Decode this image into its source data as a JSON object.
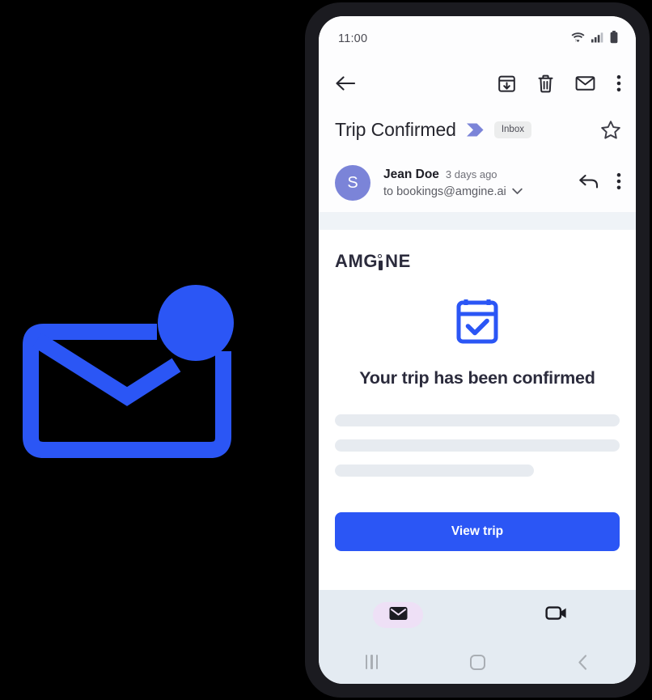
{
  "illustration": {
    "name": "envelope-with-notification-dot",
    "color": "#2b56f5",
    "background": "#000000"
  },
  "phone": {
    "frame_color": "#1b1b20",
    "screen_background": "#ffffff"
  },
  "status_bar": {
    "time": "11:00",
    "icons": [
      "wifi-icon",
      "cellular-signal-icon",
      "battery-icon"
    ]
  },
  "toolbar": {
    "back_icon": "arrow-left-icon",
    "actions": [
      {
        "icon": "archive-icon",
        "label": "Archive"
      },
      {
        "icon": "delete-icon",
        "label": "Delete"
      },
      {
        "icon": "mark-unread-icon",
        "label": "Mark unread"
      },
      {
        "icon": "more-vert-icon",
        "label": "More options"
      }
    ]
  },
  "subject": {
    "title": "Trip Confirmed",
    "label_chevron_color": "#7b84d8",
    "badge": "Inbox",
    "star_icon": "star-outline-icon"
  },
  "sender": {
    "avatar_initial": "S",
    "avatar_color": "#7b84d8",
    "name": "Jean Doe",
    "time": "3 days ago",
    "recipient": "to bookings@amgine.ai",
    "expand_icon": "chevron-down-icon",
    "reply_icon": "reply-icon",
    "more_icon": "more-vert-icon"
  },
  "email_body": {
    "brand_prefix": "AMG",
    "brand_suffix": "NE",
    "hero_icon": "calendar-check-icon",
    "hero_icon_color": "#2b56f5",
    "heading": "Your trip has been confirmed",
    "skeleton_widths": [
      "100%",
      "100%",
      "70%"
    ],
    "cta_label": "View trip",
    "cta_color": "#2b56f5"
  },
  "app_nav": {
    "background": "#e4ebf2",
    "items": [
      {
        "icon": "mail-filled-icon",
        "label": "Mail",
        "active": true,
        "pill_color": "#eee0f6"
      },
      {
        "icon": "video-camera-icon",
        "label": "Meet",
        "active": false
      }
    ]
  },
  "system_nav": {
    "recents_icon": "recents-icon",
    "home_icon": "home-icon",
    "back_icon": "back-chevron-icon"
  }
}
